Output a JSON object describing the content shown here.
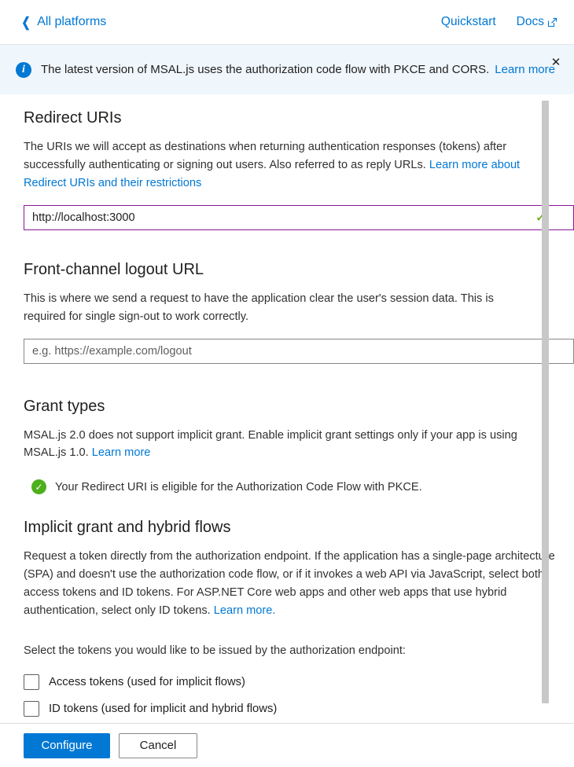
{
  "topbar": {
    "back_label": "All platforms",
    "back_icon": "chevron-left-icon",
    "links": [
      {
        "label": "Quickstart",
        "icon": null
      },
      {
        "label": "Docs",
        "icon": "external-link-icon"
      }
    ]
  },
  "banner": {
    "icon": "info-circle-icon",
    "message": "The latest version of MSAL.js uses the authorization code flow with PKCE and CORS.",
    "link_label": "Learn more",
    "close_icon": "close-icon",
    "background_color": "#EFF6FC",
    "accent_color": "#0078D4"
  },
  "redirect_uris": {
    "title": "Redirect URIs",
    "description_part1": "The URIs we will accept as destinations when returning authentication responses (tokens) after successfully authenticating or signing out users. Also referred to as reply URLs. ",
    "link_label": "Learn more about Redirect URIs and their restrictions",
    "input_value": "http://localhost:3000",
    "input_valid_icon": "checkmark-icon",
    "input_border_color": "#881798",
    "valid_icon_color": "#5BA300"
  },
  "front_channel_logout": {
    "title": "Front-channel logout URL",
    "description": "This is where we send a request to have the application clear the user's session data. This is required for single sign-out to work correctly.",
    "input_value": "",
    "input_placeholder": "e.g. https://example.com/logout"
  },
  "grant_types": {
    "title": "Grant types",
    "description_part1": "MSAL.js 2.0 does not support implicit grant. Enable implicit grant settings only if your app is using MSAL.js 1.0. ",
    "link_label": "Learn more",
    "status_icon": "check-circle-icon",
    "status_color": "#4CAF1B",
    "status_text": "Your Redirect URI is eligible for the Authorization Code Flow with PKCE."
  },
  "implicit_grant": {
    "title": "Implicit grant and hybrid flows",
    "description_part1": "Request a token directly from the authorization endpoint. If the application has a single-page architecture (SPA) and doesn't use the authorization code flow, or if it invokes a web API via JavaScript, select both access tokens and ID tokens. For ASP.NET Core web apps and other web apps that use hybrid authentication, select only ID tokens. ",
    "link_label": "Learn more.",
    "select_prompt": "Select the tokens you would like to be issued by the authorization endpoint:",
    "checkboxes": [
      {
        "label": "Access tokens (used for implicit flows)",
        "checked": false
      },
      {
        "label": "ID tokens (used for implicit and hybrid flows)",
        "checked": false
      }
    ]
  },
  "footer": {
    "primary_label": "Configure",
    "secondary_label": "Cancel",
    "primary_color": "#0078D4"
  }
}
